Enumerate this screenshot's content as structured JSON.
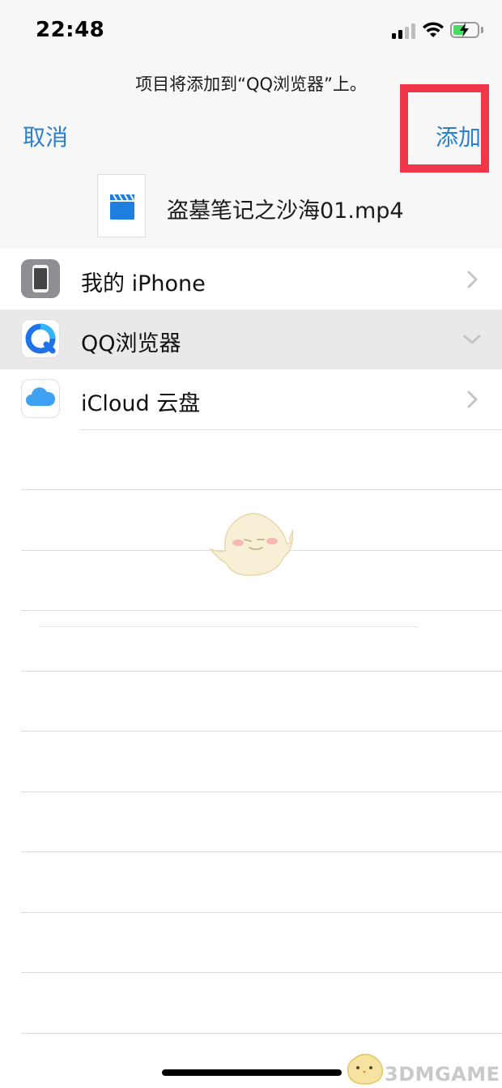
{
  "status_bar": {
    "time": "22:48"
  },
  "header": {
    "subtitle": "项目将添加到“QQ浏览器”上。",
    "cancel_label": "取消",
    "add_label": "添加"
  },
  "file": {
    "name": "盗墓笔记之沙海01.mp4",
    "icon": "video-file-icon"
  },
  "locations": [
    {
      "label": "我的 iPhone",
      "icon": "iphone-icon",
      "state": "collapsed"
    },
    {
      "label": "QQ浏览器",
      "icon": "qq-browser-icon",
      "state": "expanded-selected"
    },
    {
      "label": "iCloud 云盘",
      "icon": "icloud-icon",
      "state": "collapsed"
    }
  ],
  "watermark": {
    "text": "3DMGAME"
  },
  "colors": {
    "accent": "#2a7fd0",
    "highlight": "#f2364a",
    "battery": "#4cd964"
  }
}
